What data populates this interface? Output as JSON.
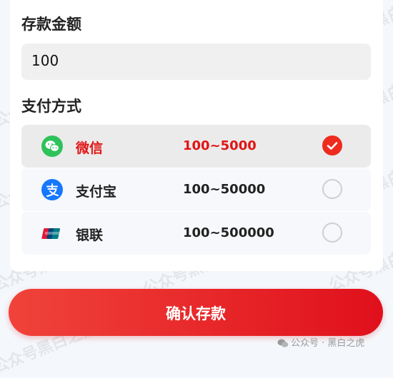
{
  "deposit": {
    "amount_label": "存款金额",
    "amount_value": "100"
  },
  "payment": {
    "label": "支付方式",
    "methods": [
      {
        "name": "微信",
        "range": "100~5000",
        "selected": true,
        "icon": "wechat-icon"
      },
      {
        "name": "支付宝",
        "range": "100~50000",
        "selected": false,
        "icon": "alipay-icon"
      },
      {
        "name": "银联",
        "range": "100~500000",
        "selected": false,
        "icon": "unionpay-icon"
      }
    ]
  },
  "confirm_label": "确认存款",
  "watermark": {
    "text": "公众号黑白之猫",
    "footer": "公众号 · 黑白之虎"
  },
  "colors": {
    "accent": "#e21414",
    "button_start": "#f0433a",
    "button_end": "#e0101c",
    "wechat": "#2fc25b",
    "alipay": "#1677ff"
  }
}
